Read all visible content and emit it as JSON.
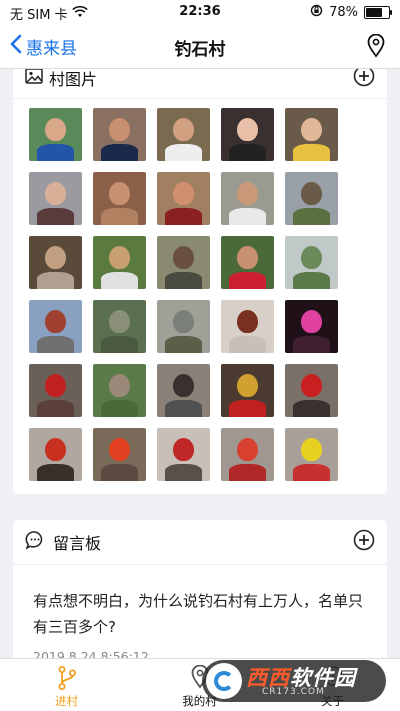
{
  "status_bar": {
    "carrier": "无 SIM 卡",
    "time": "22:36",
    "battery_text": "78%",
    "battery_level": 0.78
  },
  "nav": {
    "back_label": "惠来县",
    "title": "钓石村"
  },
  "photos_section": {
    "title": "村图片",
    "photos": [
      {
        "bg": "#5a8a5a",
        "fg": "#d8a888",
        "body": "#2255aa"
      },
      {
        "bg": "#8a7060",
        "fg": "#c89070",
        "body": "#1a2a4a"
      },
      {
        "bg": "#7a6a50",
        "fg": "#d0a080",
        "body": "#eeeeee"
      },
      {
        "bg": "#3a3030",
        "fg": "#e8c0a8",
        "body": "#222222"
      },
      {
        "bg": "#6a5a4a",
        "fg": "#e0b898",
        "body": "#e8c040"
      },
      {
        "bg": "#9a9aa0",
        "fg": "#d8b098",
        "body": "#5a3a3a"
      },
      {
        "bg": "#8a6048",
        "fg": "#c89070",
        "body": "#b08060"
      },
      {
        "bg": "#a08060",
        "fg": "#d09070",
        "body": "#8a2020"
      },
      {
        "bg": "#9a9a90",
        "fg": "#c89878",
        "body": "#e8e8e8"
      },
      {
        "bg": "#9aa0a8",
        "fg": "#6a5a48",
        "body": "#5a7040"
      },
      {
        "bg": "#5a4a3a",
        "fg": "#c0a080",
        "body": "#b0a090"
      },
      {
        "bg": "#5a7a40",
        "fg": "#c8a070",
        "body": "#e0e0e0"
      },
      {
        "bg": "#8a8a70",
        "fg": "#6a5040",
        "body": "#4a4a40"
      },
      {
        "bg": "#4a6a3a",
        "fg": "#c89070",
        "body": "#cc2030"
      },
      {
        "bg": "#c0c8c8",
        "fg": "#6a8a5a",
        "body": "#5a7a4a"
      },
      {
        "bg": "#8aa0c0",
        "fg": "#a04030",
        "body": "#707070"
      },
      {
        "bg": "#5a7050",
        "fg": "#8a9078",
        "body": "#4a5a40"
      },
      {
        "bg": "#a0a098",
        "fg": "#7a8078",
        "body": "#5a6048"
      },
      {
        "bg": "#d8d0c8",
        "fg": "#7a3020",
        "body": "#c8c0b8"
      },
      {
        "bg": "#201018",
        "fg": "#e040a0",
        "body": "#402030"
      },
      {
        "bg": "#6a6058",
        "fg": "#c02020",
        "body": "#5a4038"
      },
      {
        "bg": "#5a7a48",
        "fg": "#9a8878",
        "body": "#4a6a38"
      },
      {
        "bg": "#8a8078",
        "fg": "#3a3030",
        "body": "#505050"
      },
      {
        "bg": "#4a3a30",
        "fg": "#d0a030",
        "body": "#c02020"
      },
      {
        "bg": "#7a7068",
        "fg": "#c82020",
        "body": "#3a3030"
      },
      {
        "bg": "#b0a8a0",
        "fg": "#c83020",
        "body": "#3a3028"
      },
      {
        "bg": "#7a6a5a",
        "fg": "#e04020",
        "body": "#5a4a40"
      },
      {
        "bg": "#c8c0b8",
        "fg": "#c02828",
        "body": "#5a5048"
      },
      {
        "bg": "#a09890",
        "fg": "#d84030",
        "body": "#b02828"
      },
      {
        "bg": "#a8a098",
        "fg": "#e8d020",
        "body": "#c83030"
      }
    ]
  },
  "message_section": {
    "title": "留言板",
    "messages": [
      {
        "text": "有点想不明白，为什么说钓石村有上万人，名单只有三百多个?",
        "time": "2019.8.24 8:56:12"
      }
    ]
  },
  "tab_bar": {
    "tabs": [
      {
        "label": "进村",
        "active": true
      },
      {
        "label": "我的村",
        "active": false
      },
      {
        "label": "关于",
        "active": false
      }
    ]
  },
  "watermark": {
    "brand_a": "西西",
    "brand_b": "软件园",
    "site": "CR173.COM"
  },
  "colors": {
    "accent_blue": "#1a73e8",
    "tab_active": "#f0a020"
  }
}
